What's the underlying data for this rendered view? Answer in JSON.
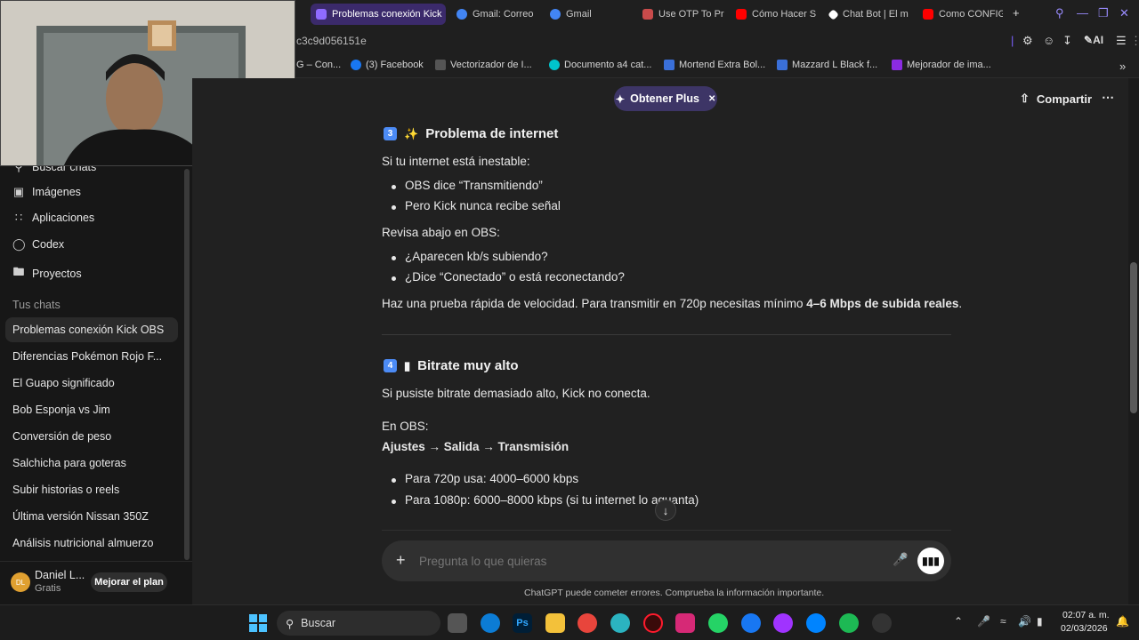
{
  "browser": {
    "tabs": [
      {
        "label": "Problemas conexión Kick",
        "active": true,
        "color": "#8f6bff"
      },
      {
        "label": "Gmail: Correo",
        "color": "#4285f4"
      },
      {
        "label": "Gmail",
        "color": "#4285f4"
      },
      {
        "label": "Use OTP To Pr",
        "color": "#c94b4b"
      },
      {
        "label": "Cómo Hacer S",
        "color": "#ff0000"
      },
      {
        "label": "Chat Bot | El m",
        "color": "#ffffff"
      },
      {
        "label": "Como CONFIG",
        "color": "#ff0000"
      }
    ],
    "new_tab_icon": "plus-icon",
    "url": "c3c9d056151e",
    "toolbar_ai_label": "AI",
    "bookmarks": [
      {
        "label": "G – Con...",
        "color": "#4285f4"
      },
      {
        "label": "(3) Facebook",
        "color": "#1877f2"
      },
      {
        "label": "Vectorizador de I...",
        "color": "#555555"
      },
      {
        "label": "Documento a4 cat...",
        "color": "#00c4cc"
      },
      {
        "label": "Mortend Extra Bol...",
        "color": "#3a6fd8"
      },
      {
        "label": "Mazzard L Black f...",
        "color": "#3a6fd8"
      },
      {
        "label": "Mejorador de ima...",
        "color": "#8b2be2"
      }
    ]
  },
  "sidebar": {
    "items": [
      {
        "label": "Buscar chats",
        "icon": "search-icon"
      },
      {
        "label": "Imágenes",
        "icon": "image-icon"
      },
      {
        "label": "Aplicaciones",
        "icon": "apps-icon"
      },
      {
        "label": "Codex",
        "icon": "codex-icon"
      },
      {
        "label": "Proyectos",
        "icon": "folder-icon"
      }
    ],
    "section_title": "Tus chats",
    "chats": [
      "Problemas conexión Kick OBS",
      "Diferencias Pokémon Rojo F...",
      "El Guapo significado",
      "Bob Esponja vs Jim",
      "Conversión de peso",
      "Salchicha para goteras",
      "Subir historias o reels",
      "Última versión Nissan 350Z",
      "Análisis nutricional almuerzo"
    ],
    "user": {
      "initials": "DL",
      "name": "Daniel L...",
      "plan": "Gratis",
      "upgrade_label": "Mejorar el plan"
    }
  },
  "header": {
    "plus_label": "Obtener Plus",
    "share_label": "Compartir"
  },
  "content": {
    "s3_num": "3",
    "s3_title": "Problema de internet",
    "s3_intro": "Si tu internet está inestable:",
    "s3_bullets": [
      "OBS dice “Transmitiendo”",
      "Pero Kick nunca recibe señal"
    ],
    "s3_check": "Revisa abajo en OBS:",
    "s3_bullets2": [
      "¿Aparecen kb/s subiendo?",
      "¿Dice “Conectado” o está reconectando?"
    ],
    "s3_speed_pre": "Haz una prueba rápida de velocidad. Para transmitir en 720p necesitas mínimo ",
    "s3_speed_bold": "4–6 Mbps de subida reales",
    "s3_speed_post": ".",
    "s4_num": "4",
    "s4_title": "Bitrate muy alto",
    "s4_intro": "Si pusiste bitrate demasiado alto, Kick no conecta.",
    "s4_obs": "En OBS:",
    "s4_path": "Ajustes → Salida → Transmisión",
    "s4_bullets": [
      "Para 720p usa: 4000–6000 kbps",
      "Para 1080p: 6000–8000 kbps (si tu internet lo aguanta)"
    ]
  },
  "composer": {
    "placeholder": "Pregunta lo que quieras",
    "disclaimer": "ChatGPT puede cometer errores. Comprueba la información importante."
  },
  "taskbar": {
    "search_label": "Buscar",
    "time": "02:07 a. m.",
    "date": "02/03/2026"
  }
}
